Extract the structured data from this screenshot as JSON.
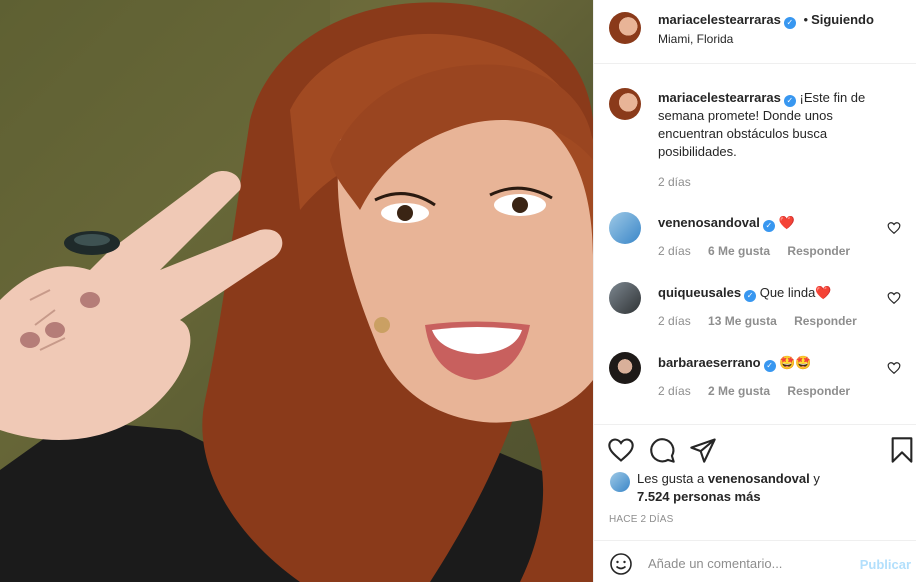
{
  "post_header": {
    "username": "mariacelestearraras",
    "separator": "•",
    "follow_status": "Siguiendo",
    "location": "Miami, Florida"
  },
  "caption": {
    "username": "mariacelestearraras",
    "text": "¡Este fin de semana promete! Donde unos encuentran obstáculos busca posibilidades.",
    "time": "2 días"
  },
  "comments": [
    {
      "username": "venenosandoval",
      "text": "❤️",
      "time": "2 días",
      "likes": "6 Me gusta",
      "reply": "Responder"
    },
    {
      "username": "quiqueusales",
      "text": "Que linda❤️",
      "time": "2 días",
      "likes": "13 Me gusta",
      "reply": "Responder"
    },
    {
      "username": "barbaraeserrano",
      "text": "🤩🤩",
      "time": "2 días",
      "likes": "2 Me gusta",
      "reply": "Responder"
    }
  ],
  "likes": {
    "prefix": "Les gusta a",
    "user": "venenosandoval",
    "suffix": "y",
    "others": "7.524 personas más"
  },
  "post_time": "Hace 2 días",
  "comment_box": {
    "placeholder": "Añade un comentario...",
    "publish": "Publicar"
  },
  "colors": {
    "verified": "#3897f0",
    "heart_red": "#ed4956",
    "publish_disabled": "#b2dffc",
    "muted": "#8e8e8e"
  },
  "icons": [
    "heart-icon",
    "comment-icon",
    "share-icon",
    "bookmark-icon",
    "emoji-icon",
    "verified-icon"
  ]
}
